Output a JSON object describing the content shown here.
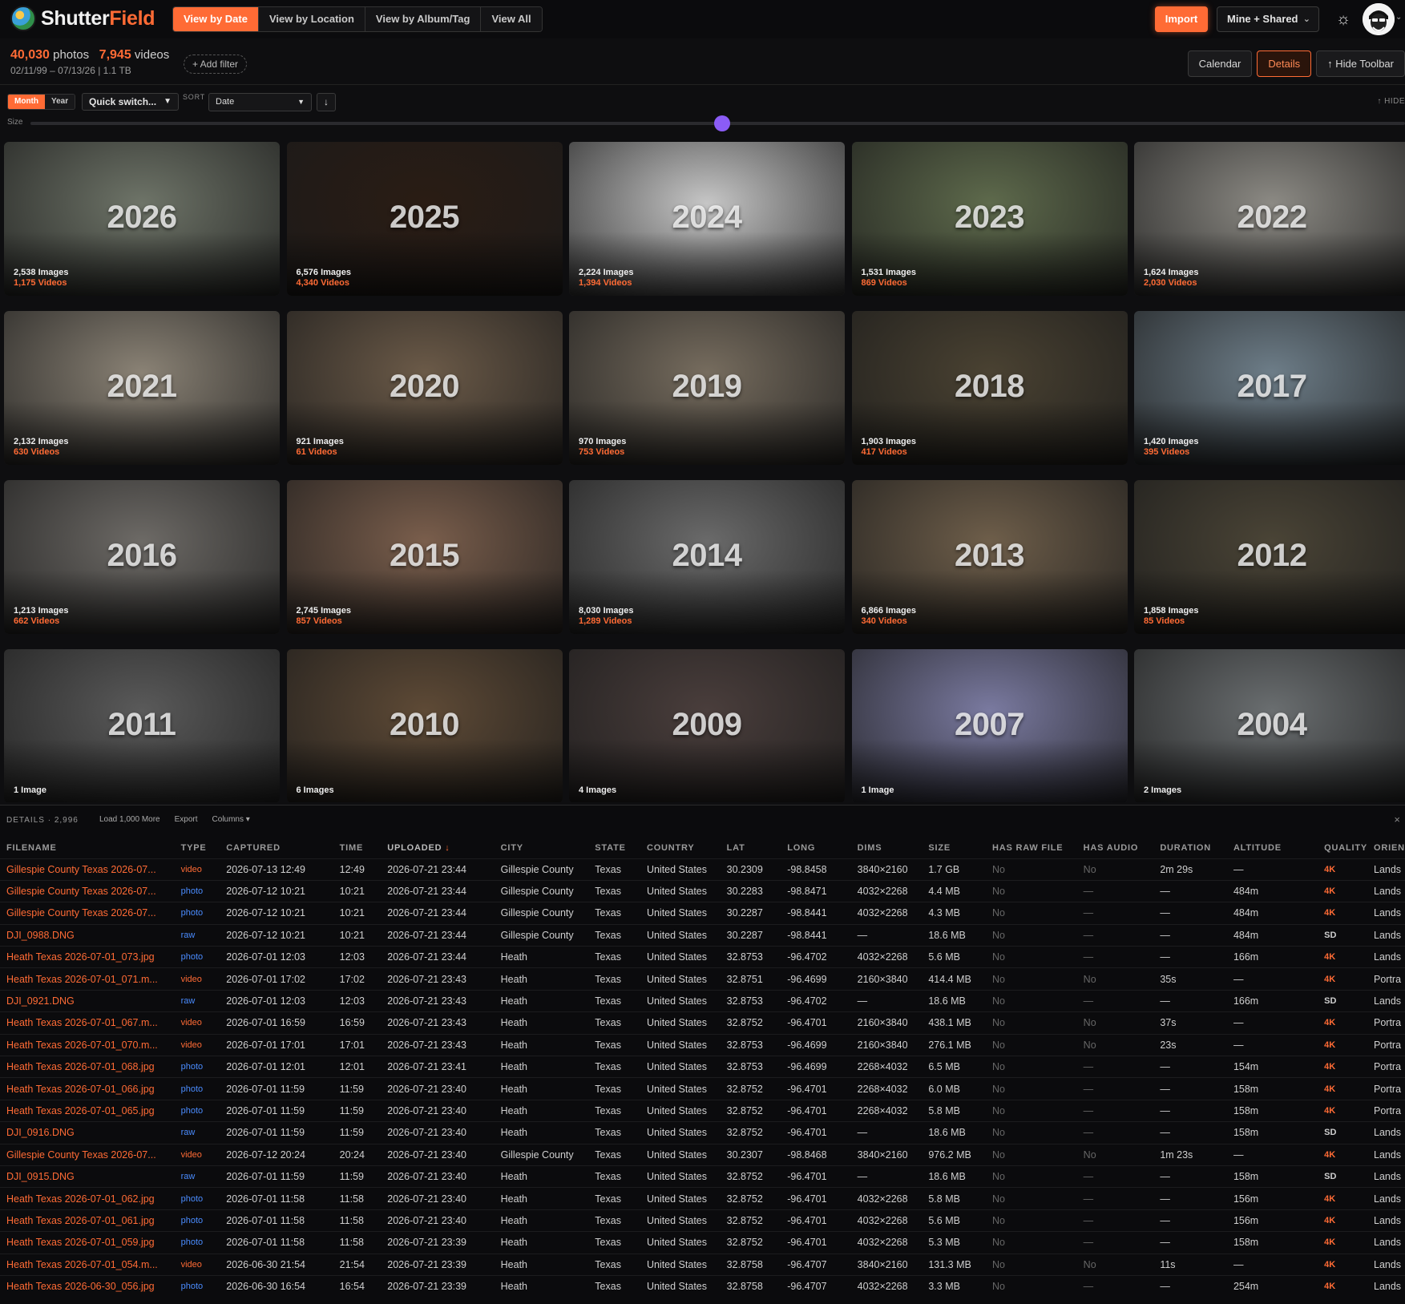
{
  "app": {
    "name_main": "Shutter",
    "name_accent": "Field",
    "nav_tabs": [
      "View by Date",
      "View by Location",
      "View by Album/Tag",
      "View All"
    ],
    "active_tab": 0,
    "import_label": "Import",
    "scope_label": "Mine + Shared",
    "accent_color": "#ff6b35"
  },
  "stats": {
    "photos_count": "40,030",
    "photos_label": "photos",
    "videos_count": "7,945",
    "videos_label": "videos",
    "date_range": "02/11/99 – 07/13/26 | 1.1 TB",
    "add_filter": "+ Add filter"
  },
  "view_buttons": {
    "calendar": "Calendar",
    "details": "Details",
    "hide_toolbar": "↑ Hide Toolbar"
  },
  "toolbar": {
    "mode_month": "Month",
    "mode_year": "Year",
    "quick_switch": "Quick switch...",
    "sort_label": "SORT",
    "sort_value": "Date",
    "sort_direction": "↓",
    "hide_label": "↑ HIDE",
    "size_label": "Size",
    "size_level": 0.5
  },
  "years": [
    {
      "year": "2026",
      "images": "2,538 Images",
      "videos": "1,175 Videos",
      "bg": "#6e7468"
    },
    {
      "year": "2025",
      "images": "6,576 Images",
      "videos": "4,340 Videos",
      "bg": "#2a1c14"
    },
    {
      "year": "2024",
      "images": "2,224 Images",
      "videos": "1,394 Videos",
      "bg": "#c6c6c6"
    },
    {
      "year": "2023",
      "images": "1,531 Images",
      "videos": "869 Videos",
      "bg": "#5e6a4c"
    },
    {
      "year": "2022",
      "images": "1,624 Images",
      "videos": "2,030 Videos",
      "bg": "#8c8a84"
    },
    {
      "year": "2021",
      "images": "2,132 Images",
      "videos": "630 Videos",
      "bg": "#8a8275"
    },
    {
      "year": "2020",
      "images": "921 Images",
      "videos": "61 Videos",
      "bg": "#6b5a48"
    },
    {
      "year": "2019",
      "images": "970 Images",
      "videos": "753 Videos",
      "bg": "#766c5e"
    },
    {
      "year": "2018",
      "images": "1,903 Images",
      "videos": "417 Videos",
      "bg": "#4a4232"
    },
    {
      "year": "2017",
      "images": "1,420 Images",
      "videos": "395 Videos",
      "bg": "#6d7d88"
    },
    {
      "year": "2016",
      "images": "1,213 Images",
      "videos": "662 Videos",
      "bg": "#6d6a66"
    },
    {
      "year": "2015",
      "images": "2,745 Images",
      "videos": "857 Videos",
      "bg": "#7a5e4c"
    },
    {
      "year": "2014",
      "images": "8,030 Images",
      "videos": "1,289 Videos",
      "bg": "#6a6a6a"
    },
    {
      "year": "2013",
      "images": "6,866 Images",
      "videos": "340 Videos",
      "bg": "#6e5e4a"
    },
    {
      "year": "2012",
      "images": "1,858 Images",
      "videos": "85 Videos",
      "bg": "#4a4436"
    },
    {
      "year": "2011",
      "images": "1 Image",
      "videos": "",
      "bg": "#5a5a5a"
    },
    {
      "year": "2010",
      "images": "6 Images",
      "videos": "",
      "bg": "#5e4a36"
    },
    {
      "year": "2009",
      "images": "4 Images",
      "videos": "",
      "bg": "#4a3e3c"
    },
    {
      "year": "2007",
      "images": "1 Image",
      "videos": "",
      "bg": "#7a7aa0"
    },
    {
      "year": "2004",
      "images": "2 Images",
      "videos": "",
      "bg": "#6a6e70"
    }
  ],
  "details": {
    "title": "DETAILS · 2,996",
    "load_more": "Load 1,000 More",
    "export": "Export",
    "columns": "Columns ▾",
    "close": "×",
    "headers": [
      "FILENAME",
      "TYPE",
      "CAPTURED",
      "TIME",
      "UPLOADED",
      "CITY",
      "STATE",
      "COUNTRY",
      "LAT",
      "LONG",
      "DIMS",
      "SIZE",
      "HAS RAW FILE",
      "HAS AUDIO",
      "DURATION",
      "ALTITUDE",
      "QUALITY",
      "ORIEN"
    ],
    "sorted_column": 4,
    "rows": [
      [
        "Gillespie County Texas 2026-07...",
        "video",
        "2026-07-13 12:49",
        "12:49",
        "2026-07-21 23:44",
        "Gillespie County",
        "Texas",
        "United States",
        "30.2309",
        "-98.8458",
        "3840×2160",
        "1.7 GB",
        "No",
        "No",
        "2m 29s",
        "—",
        "4K",
        "Lands"
      ],
      [
        "Gillespie County Texas 2026-07...",
        "photo",
        "2026-07-12 10:21",
        "10:21",
        "2026-07-21 23:44",
        "Gillespie County",
        "Texas",
        "United States",
        "30.2283",
        "-98.8471",
        "4032×2268",
        "4.4 MB",
        "No",
        "—",
        "—",
        "484m",
        "4K",
        "Lands"
      ],
      [
        "Gillespie County Texas 2026-07...",
        "photo",
        "2026-07-12 10:21",
        "10:21",
        "2026-07-21 23:44",
        "Gillespie County",
        "Texas",
        "United States",
        "30.2287",
        "-98.8441",
        "4032×2268",
        "4.3 MB",
        "No",
        "—",
        "—",
        "484m",
        "4K",
        "Lands"
      ],
      [
        "DJI_0988.DNG",
        "raw",
        "2026-07-12 10:21",
        "10:21",
        "2026-07-21 23:44",
        "Gillespie County",
        "Texas",
        "United States",
        "30.2287",
        "-98.8441",
        "—",
        "18.6 MB",
        "No",
        "—",
        "—",
        "484m",
        "SD",
        "Lands"
      ],
      [
        "Heath Texas 2026-07-01_073.jpg",
        "photo",
        "2026-07-01 12:03",
        "12:03",
        "2026-07-21 23:44",
        "Heath",
        "Texas",
        "United States",
        "32.8753",
        "-96.4702",
        "4032×2268",
        "5.6 MB",
        "No",
        "—",
        "—",
        "166m",
        "4K",
        "Lands"
      ],
      [
        "Heath Texas 2026-07-01_071.m...",
        "video",
        "2026-07-01 17:02",
        "17:02",
        "2026-07-21 23:43",
        "Heath",
        "Texas",
        "United States",
        "32.8751",
        "-96.4699",
        "2160×3840",
        "414.4 MB",
        "No",
        "No",
        "35s",
        "—",
        "4K",
        "Portra"
      ],
      [
        "DJI_0921.DNG",
        "raw",
        "2026-07-01 12:03",
        "12:03",
        "2026-07-21 23:43",
        "Heath",
        "Texas",
        "United States",
        "32.8753",
        "-96.4702",
        "—",
        "18.6 MB",
        "No",
        "—",
        "—",
        "166m",
        "SD",
        "Lands"
      ],
      [
        "Heath Texas 2026-07-01_067.m...",
        "video",
        "2026-07-01 16:59",
        "16:59",
        "2026-07-21 23:43",
        "Heath",
        "Texas",
        "United States",
        "32.8752",
        "-96.4701",
        "2160×3840",
        "438.1 MB",
        "No",
        "No",
        "37s",
        "—",
        "4K",
        "Portra"
      ],
      [
        "Heath Texas 2026-07-01_070.m...",
        "video",
        "2026-07-01 17:01",
        "17:01",
        "2026-07-21 23:43",
        "Heath",
        "Texas",
        "United States",
        "32.8753",
        "-96.4699",
        "2160×3840",
        "276.1 MB",
        "No",
        "No",
        "23s",
        "—",
        "4K",
        "Portra"
      ],
      [
        "Heath Texas 2026-07-01_068.jpg",
        "photo",
        "2026-07-01 12:01",
        "12:01",
        "2026-07-21 23:41",
        "Heath",
        "Texas",
        "United States",
        "32.8753",
        "-96.4699",
        "2268×4032",
        "6.5 MB",
        "No",
        "—",
        "—",
        "154m",
        "4K",
        "Portra"
      ],
      [
        "Heath Texas 2026-07-01_066.jpg",
        "photo",
        "2026-07-01 11:59",
        "11:59",
        "2026-07-21 23:40",
        "Heath",
        "Texas",
        "United States",
        "32.8752",
        "-96.4701",
        "2268×4032",
        "6.0 MB",
        "No",
        "—",
        "—",
        "158m",
        "4K",
        "Portra"
      ],
      [
        "Heath Texas 2026-07-01_065.jpg",
        "photo",
        "2026-07-01 11:59",
        "11:59",
        "2026-07-21 23:40",
        "Heath",
        "Texas",
        "United States",
        "32.8752",
        "-96.4701",
        "2268×4032",
        "5.8 MB",
        "No",
        "—",
        "—",
        "158m",
        "4K",
        "Portra"
      ],
      [
        "DJI_0916.DNG",
        "raw",
        "2026-07-01 11:59",
        "11:59",
        "2026-07-21 23:40",
        "Heath",
        "Texas",
        "United States",
        "32.8752",
        "-96.4701",
        "—",
        "18.6 MB",
        "No",
        "—",
        "—",
        "158m",
        "SD",
        "Lands"
      ],
      [
        "Gillespie County Texas 2026-07...",
        "video",
        "2026-07-12 20:24",
        "20:24",
        "2026-07-21 23:40",
        "Gillespie County",
        "Texas",
        "United States",
        "30.2307",
        "-98.8468",
        "3840×2160",
        "976.2 MB",
        "No",
        "No",
        "1m 23s",
        "—",
        "4K",
        "Lands"
      ],
      [
        "DJI_0915.DNG",
        "raw",
        "2026-07-01 11:59",
        "11:59",
        "2026-07-21 23:40",
        "Heath",
        "Texas",
        "United States",
        "32.8752",
        "-96.4701",
        "—",
        "18.6 MB",
        "No",
        "—",
        "—",
        "158m",
        "SD",
        "Lands"
      ],
      [
        "Heath Texas 2026-07-01_062.jpg",
        "photo",
        "2026-07-01 11:58",
        "11:58",
        "2026-07-21 23:40",
        "Heath",
        "Texas",
        "United States",
        "32.8752",
        "-96.4701",
        "4032×2268",
        "5.8 MB",
        "No",
        "—",
        "—",
        "156m",
        "4K",
        "Lands"
      ],
      [
        "Heath Texas 2026-07-01_061.jpg",
        "photo",
        "2026-07-01 11:58",
        "11:58",
        "2026-07-21 23:40",
        "Heath",
        "Texas",
        "United States",
        "32.8752",
        "-96.4701",
        "4032×2268",
        "5.6 MB",
        "No",
        "—",
        "—",
        "156m",
        "4K",
        "Lands"
      ],
      [
        "Heath Texas 2026-07-01_059.jpg",
        "photo",
        "2026-07-01 11:58",
        "11:58",
        "2026-07-21 23:39",
        "Heath",
        "Texas",
        "United States",
        "32.8752",
        "-96.4701",
        "4032×2268",
        "5.3 MB",
        "No",
        "—",
        "—",
        "158m",
        "4K",
        "Lands"
      ],
      [
        "Heath Texas 2026-07-01_054.m...",
        "video",
        "2026-06-30 21:54",
        "21:54",
        "2026-07-21 23:39",
        "Heath",
        "Texas",
        "United States",
        "32.8758",
        "-96.4707",
        "3840×2160",
        "131.3 MB",
        "No",
        "No",
        "11s",
        "—",
        "4K",
        "Lands"
      ],
      [
        "Heath Texas 2026-06-30_056.jpg",
        "photo",
        "2026-06-30 16:54",
        "16:54",
        "2026-07-21 23:39",
        "Heath",
        "Texas",
        "United States",
        "32.8758",
        "-96.4707",
        "4032×2268",
        "3.3 MB",
        "No",
        "—",
        "—",
        "254m",
        "4K",
        "Lands"
      ]
    ]
  }
}
